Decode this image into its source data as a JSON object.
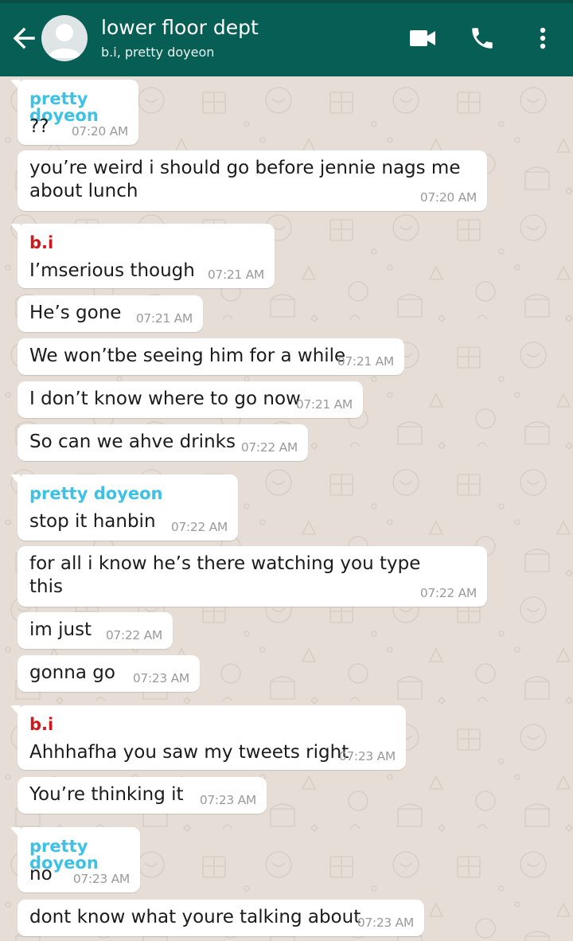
{
  "header": {
    "title": "lower floor dept",
    "subtitle": "b.i, pretty doyeon",
    "icons": [
      "back-arrow-icon",
      "avatar",
      "video-call-icon",
      "voice-call-icon",
      "more-options-icon"
    ],
    "color": "#075e54"
  },
  "colors": {
    "sender_doyeon": "#3dc2e6",
    "sender_bi": "#d0191b",
    "bubble": "#ffffff",
    "wallpaper": "#e6ded6"
  },
  "messages": [
    {
      "sender": "pretty doyeon",
      "lines": [
        "??"
      ],
      "time": "07:20 AM"
    },
    {
      "sender": "",
      "lines": [
        "you’re weird i should go before jennie nags me",
        "about lunch"
      ],
      "time": "07:20 AM"
    },
    {
      "sender": "b.i",
      "lines": [
        "I’mserious though"
      ],
      "time": "07:21 AM"
    },
    {
      "sender": "",
      "lines": [
        "He’s gone"
      ],
      "time": "07:21 AM"
    },
    {
      "sender": "",
      "lines": [
        "We won’tbe seeing him for a while"
      ],
      "time": "07:21 AM"
    },
    {
      "sender": "",
      "lines": [
        "I don’t know where to go now"
      ],
      "time": "07:21 AM"
    },
    {
      "sender": "",
      "lines": [
        "So can we ahve drinks"
      ],
      "time": "07:22 AM"
    },
    {
      "sender": "pretty doyeon",
      "lines": [
        "stop it hanbin"
      ],
      "time": "07:22 AM"
    },
    {
      "sender": "",
      "lines": [
        "for all i know he’s there watching you type",
        "this"
      ],
      "time": "07:22 AM"
    },
    {
      "sender": "",
      "lines": [
        "im just"
      ],
      "time": "07:22 AM"
    },
    {
      "sender": "",
      "lines": [
        "gonna go"
      ],
      "time": "07:23 AM"
    },
    {
      "sender": "b.i",
      "lines": [
        "Ahhhafha you saw my tweets right"
      ],
      "time": "07:23 AM"
    },
    {
      "sender": "",
      "lines": [
        "You’re thinking it"
      ],
      "time": "07:23 AM"
    },
    {
      "sender": "pretty doyeon",
      "lines": [
        "no"
      ],
      "time": "07:23 AM"
    },
    {
      "sender": "",
      "lines": [
        "dont know what youre talking about"
      ],
      "time": "07:23 AM"
    }
  ]
}
